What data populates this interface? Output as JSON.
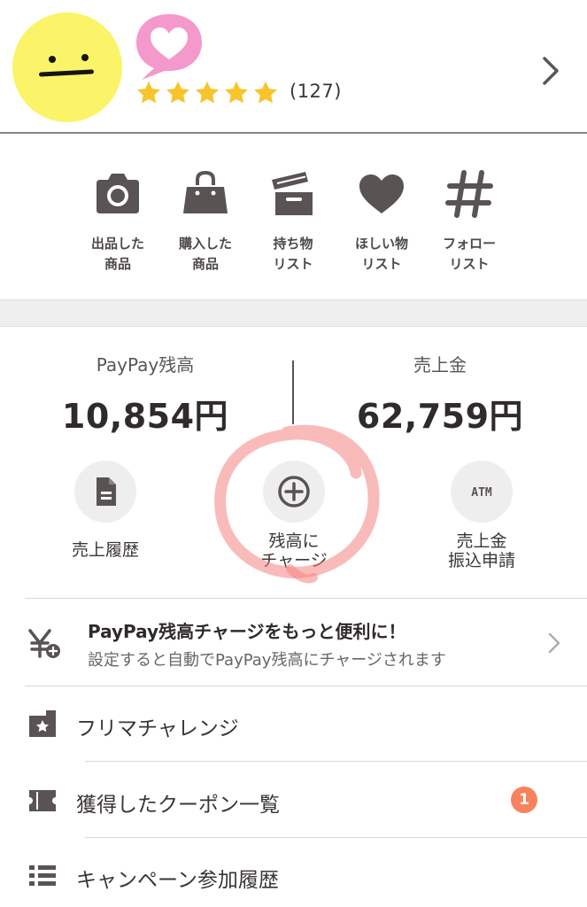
{
  "profile": {
    "review_count": "(127)",
    "rating_stars": 5,
    "colors": {
      "avatar": "#fbf468",
      "bubble": "#f598cb",
      "star": "#f7c42b"
    }
  },
  "shortcuts": [
    {
      "line1": "出品した",
      "line2": "商品",
      "icon": "camera-icon"
    },
    {
      "line1": "購入した",
      "line2": "商品",
      "icon": "shopping-bag-icon"
    },
    {
      "line1": "持ち物",
      "line2": "リスト",
      "icon": "box-icon"
    },
    {
      "line1": "ほしい物",
      "line2": "リスト",
      "icon": "heart-icon"
    },
    {
      "line1": "フォロー",
      "line2": "リスト",
      "icon": "hashtag-icon"
    }
  ],
  "balance": {
    "paypay": {
      "label": "PayPay残高",
      "value": "10,854円"
    },
    "sales": {
      "label": "売上金",
      "value": "62,759円"
    }
  },
  "actions": [
    {
      "line1": "売上履歴",
      "line2": "",
      "icon": "document-icon"
    },
    {
      "line1": "残高に",
      "line2": "チャージ",
      "icon": "plus-circle-icon"
    },
    {
      "line1": "売上金",
      "line2": "振込申請",
      "icon": "atm-icon",
      "icon_text": "ATM"
    }
  ],
  "promo": {
    "title": "PayPay残高チャージをもっと便利に！",
    "subtitle": "設定すると自動でPayPay残高にチャージされます",
    "icon": "yen-plus-icon"
  },
  "menu": [
    {
      "label": "フリマチャレンジ",
      "icon": "star-ticket-icon"
    },
    {
      "label": "獲得したクーポン一覧",
      "icon": "coupon-icon",
      "badge": "1"
    },
    {
      "label": "キャンペーン参加履歴",
      "icon": "list-icon"
    }
  ],
  "colors": {
    "icon": "#5a5354",
    "badge": "#f7825b",
    "annotation": "#f4837f"
  }
}
